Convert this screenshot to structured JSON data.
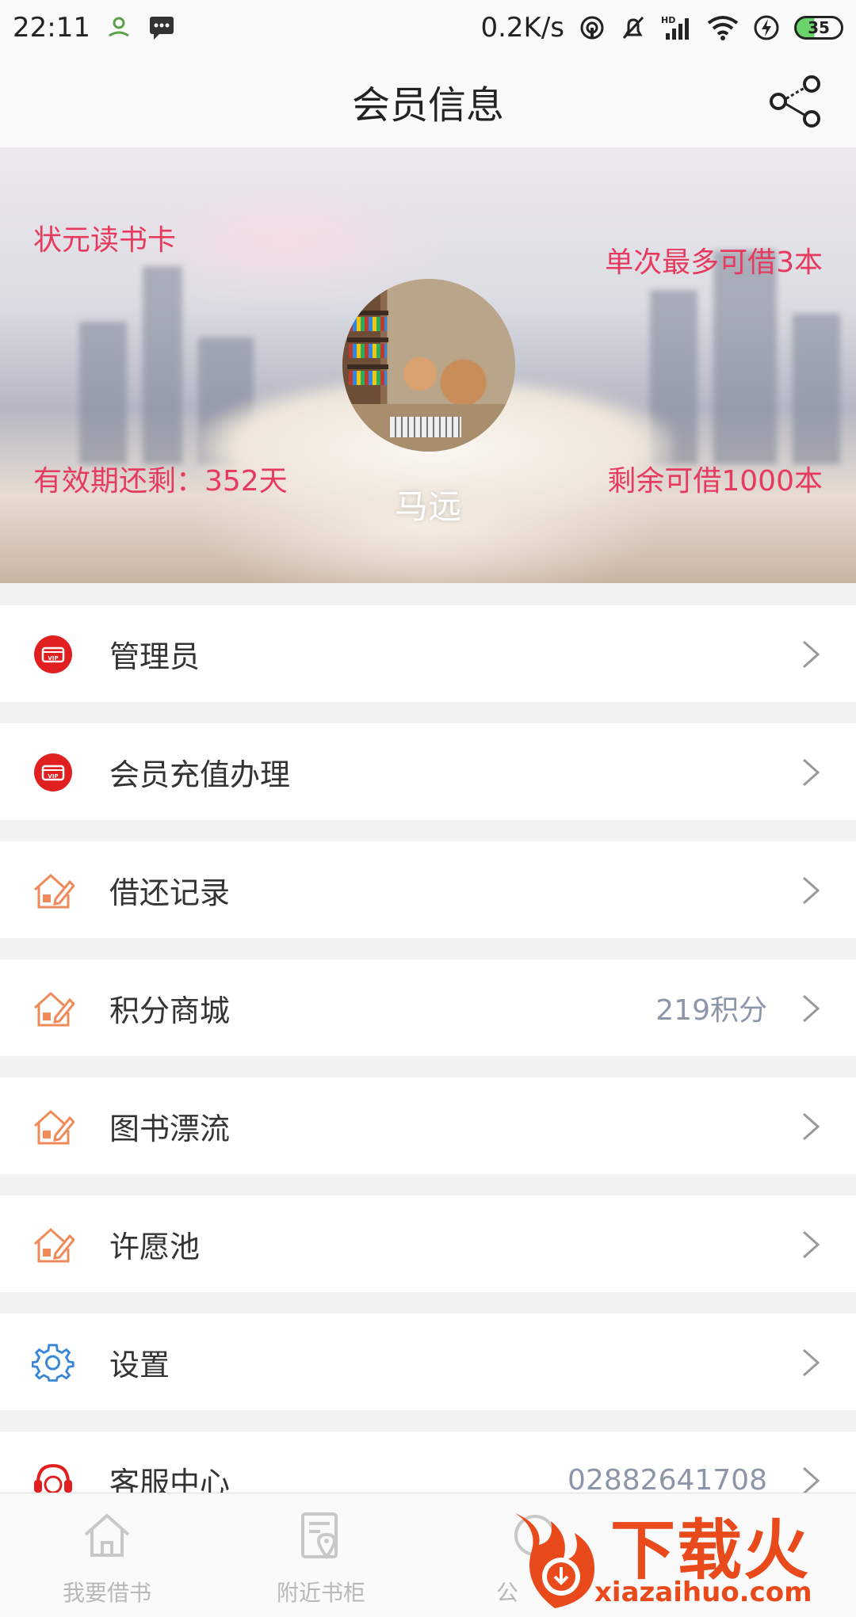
{
  "status_bar": {
    "time": "22:11",
    "net_speed": "0.2K/s",
    "battery": "35"
  },
  "header": {
    "title": "会员信息"
  },
  "banner": {
    "card_name": "状元读书卡",
    "borrow_limit": "单次最多可借3本",
    "validity": "有效期还剩：352天",
    "remaining": "剩余可借1000本",
    "username": "马远"
  },
  "menu": [
    {
      "label": "管理员",
      "value": "",
      "icon": "vip-card-icon"
    },
    {
      "label": "会员充值办理",
      "value": "",
      "icon": "vip-card-icon"
    },
    {
      "label": "借还记录",
      "value": "",
      "icon": "house-pen-icon"
    },
    {
      "label": "积分商城",
      "value": "219积分",
      "icon": "house-pen-icon"
    },
    {
      "label": "图书漂流",
      "value": "",
      "icon": "house-pen-icon"
    },
    {
      "label": "许愿池",
      "value": "",
      "icon": "house-pen-icon"
    },
    {
      "label": "设置",
      "value": "",
      "icon": "gear-icon"
    },
    {
      "label": "客服中心",
      "value": "02882641708",
      "icon": "headset-icon"
    }
  ],
  "bottom_nav": [
    {
      "label": "我要借书",
      "icon": "home-icon"
    },
    {
      "label": "附近书柜",
      "icon": "location-doc-icon"
    },
    {
      "label": "公",
      "icon": "notice-icon"
    }
  ],
  "watermark": {
    "brand": "下载火",
    "url": "xiazaihuo.com"
  },
  "colors": {
    "accent_red": "#e02020",
    "accent_orange": "#ef8a5a",
    "banner_text": "#e63a5e",
    "gear_blue": "#3a86d6",
    "value_gray": "#8c96a8"
  }
}
